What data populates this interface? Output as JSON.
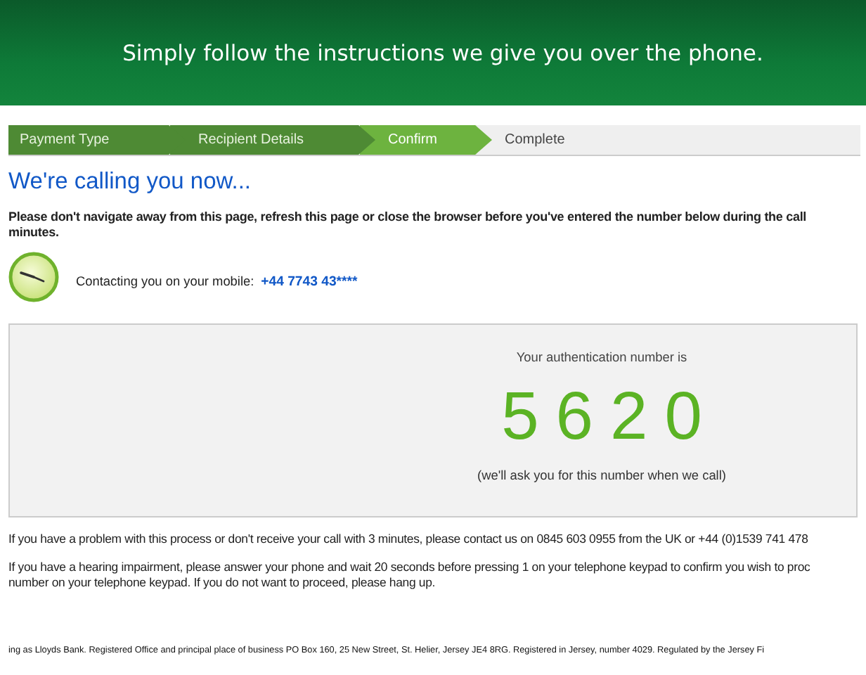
{
  "banner": {
    "text": "Simply follow the instructions we give you over the phone."
  },
  "steps": [
    {
      "label": "Payment Type",
      "completed": true,
      "selected": false
    },
    {
      "label": "Recipient Details",
      "completed": true,
      "selected": false
    },
    {
      "label": "Confirm",
      "completed": false,
      "selected": true
    },
    {
      "label": "Complete",
      "completed": false,
      "selected": false
    }
  ],
  "heading": "We're calling you now...",
  "warning_lines": [
    "Please don't navigate away from this page, refresh this page or close the browser before you've entered the number below during the call",
    "minutes."
  ],
  "contact": {
    "label": "Contacting you on your mobile:",
    "number": "+44 7743 43****"
  },
  "auth_panel": {
    "title": "Your authentication number is",
    "digits": [
      "5",
      "6",
      "2",
      "0"
    ],
    "note": "(we'll ask you for this number when we call)"
  },
  "help_paragraphs": [
    [
      "If you have a problem with this process or don't receive your call with 3 minutes, please contact us on 0845 603 0955 from the UK or +44 (0)1539 741 478"
    ],
    [
      "If you have a hearing impairment, please answer your phone and wait 20 seconds before pressing 1 on your telephone keypad to confirm you wish to proc",
      "number on your telephone keypad. If you do not want to proceed, please hang up."
    ]
  ],
  "footer": "ing as Lloyds Bank. Registered Office and principal place of business PO Box 160, 25 New Street, St. Helier, Jersey JE4 8RG. Registered in Jersey, number 4029. Regulated by the Jersey Fi"
}
